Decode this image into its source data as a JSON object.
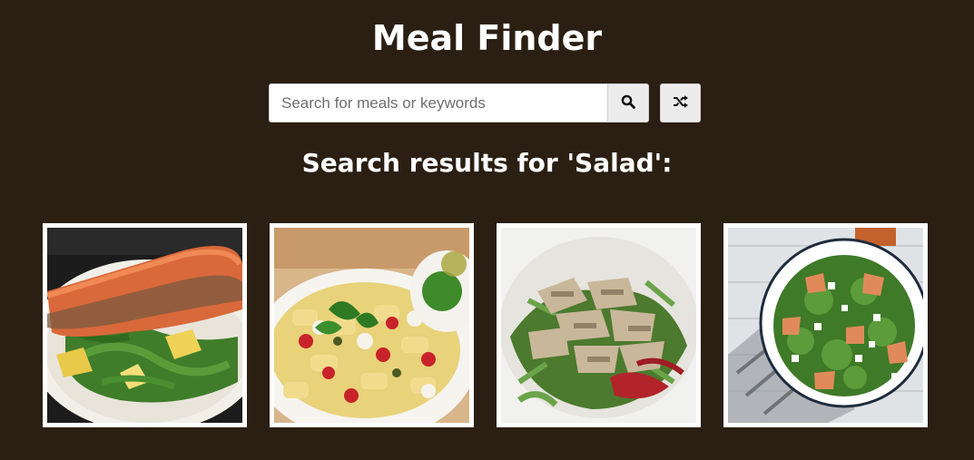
{
  "app": {
    "title": "Meal Finder"
  },
  "search": {
    "placeholder": "Search for meals or keywords",
    "value": "",
    "search_icon": "search-icon",
    "random_icon": "shuffle-icon"
  },
  "results": {
    "heading": "Search results for 'Salad':",
    "meals": [
      {
        "image": "salmon-salad"
      },
      {
        "image": "pasta-salad"
      },
      {
        "image": "chicken-salad"
      },
      {
        "image": "rocket-peach-salad"
      }
    ]
  },
  "colors": {
    "background": "#2b1f13",
    "text": "#ffffff",
    "button_bg": "#ececec"
  }
}
